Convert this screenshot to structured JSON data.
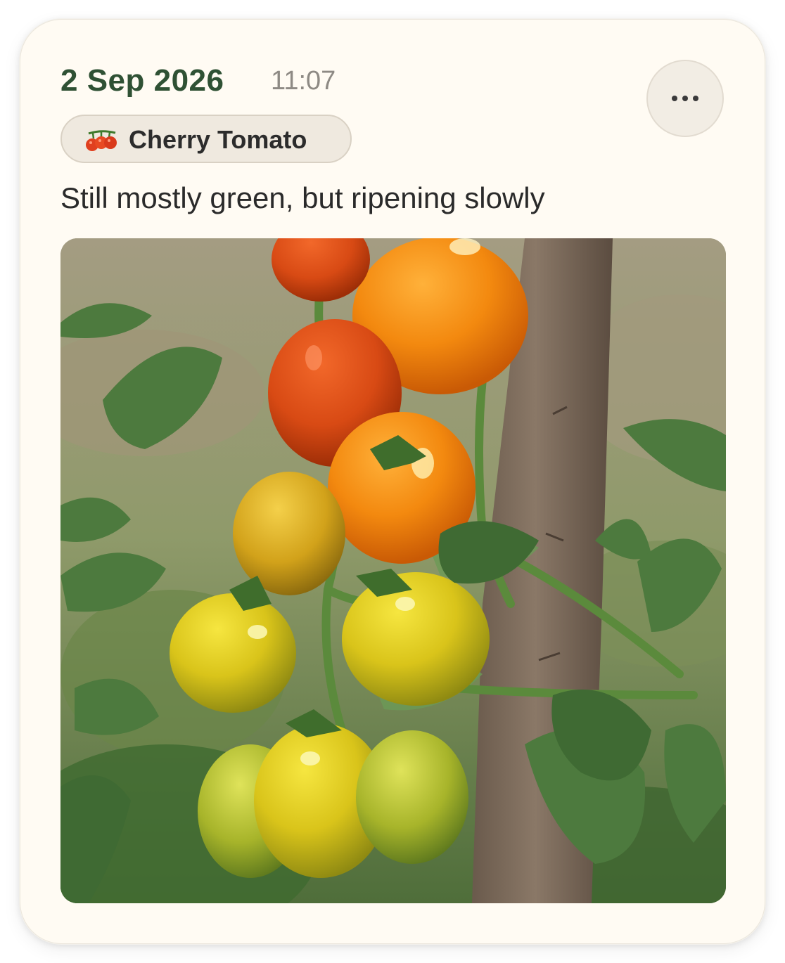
{
  "entry": {
    "date": "2 Sep 2026",
    "time": "11:07",
    "plant_tag": {
      "icon": "cherry-tomato-icon",
      "label": "Cherry Tomato"
    },
    "note": "Still mostly green, but ripening slowly",
    "photo": {
      "subject": "cherry-tomato-truss-photo"
    }
  },
  "actions": {
    "more_icon": "ellipsis-icon"
  },
  "colors": {
    "date_text": "#2f5134",
    "card_background": "#fffbf3",
    "chip_background": "#efe9df"
  }
}
